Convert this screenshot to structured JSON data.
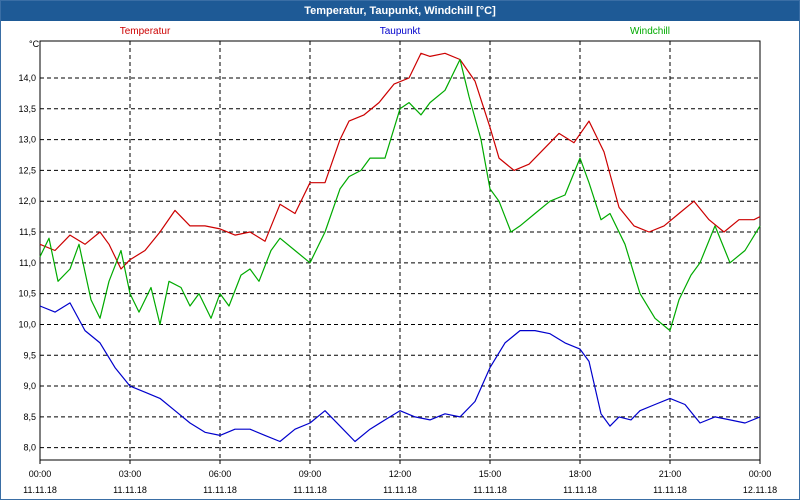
{
  "window": {
    "title": "Temperatur, Taupunkt, Windchill [°C]"
  },
  "chart_data": {
    "type": "line",
    "title": "Temperatur, Taupunkt, Windchill [°C]",
    "yunit": "°C",
    "ylim": [
      7.8,
      14.6
    ],
    "xlim": [
      0,
      24
    ],
    "grid": true,
    "yticks": [
      8.0,
      8.5,
      9.0,
      9.5,
      10.0,
      10.5,
      11.0,
      11.5,
      12.0,
      12.5,
      13.0,
      13.5,
      14.0
    ],
    "ytick_labels": [
      "8,0",
      "8,5",
      "9,0",
      "9,5",
      "10,0",
      "10,5",
      "11,0",
      "11,5",
      "12,0",
      "12,5",
      "13,0",
      "13,5",
      "14,0"
    ],
    "xticks": [
      {
        "time": "00:00",
        "date": "11.11.18",
        "hour": 0
      },
      {
        "time": "03:00",
        "date": "11.11.18",
        "hour": 3
      },
      {
        "time": "06:00",
        "date": "11.11.18",
        "hour": 6
      },
      {
        "time": "09:00",
        "date": "11.11.18",
        "hour": 9
      },
      {
        "time": "12:00",
        "date": "11.11.18",
        "hour": 12
      },
      {
        "time": "15:00",
        "date": "11.11.18",
        "hour": 15
      },
      {
        "time": "18:00",
        "date": "11.11.18",
        "hour": 18
      },
      {
        "time": "21:00",
        "date": "11.11.18",
        "hour": 21
      },
      {
        "time": "00:00",
        "date": "12.11.18",
        "hour": 24
      }
    ],
    "legend_placement": "top",
    "series": [
      {
        "name": "Temperatur",
        "color": "#cc0000",
        "x": [
          0,
          0.5,
          1,
          1.5,
          2,
          2.3,
          2.7,
          3,
          3.5,
          4,
          4.5,
          5,
          5.5,
          6,
          6.5,
          7,
          7.5,
          8,
          8.5,
          9,
          9.5,
          10,
          10.3,
          10.8,
          11.3,
          11.8,
          12.3,
          12.7,
          13,
          13.5,
          14,
          14.5,
          15,
          15.3,
          15.8,
          16.3,
          16.8,
          17.3,
          17.8,
          18.3,
          18.8,
          19.3,
          19.8,
          20.3,
          20.8,
          21.3,
          21.8,
          22.3,
          22.8,
          23.3,
          23.8,
          24
        ],
        "values": [
          11.3,
          11.2,
          11.45,
          11.3,
          11.5,
          11.3,
          10.9,
          11.05,
          11.2,
          11.5,
          11.85,
          11.6,
          11.6,
          11.55,
          11.45,
          11.5,
          11.35,
          11.95,
          11.8,
          12.3,
          12.3,
          13.0,
          13.3,
          13.4,
          13.6,
          13.9,
          14.0,
          14.4,
          14.35,
          14.4,
          14.3,
          13.95,
          13.2,
          12.7,
          12.5,
          12.6,
          12.85,
          13.1,
          12.95,
          13.3,
          12.8,
          11.9,
          11.6,
          11.5,
          11.6,
          11.8,
          12.0,
          11.7,
          11.5,
          11.7,
          11.7,
          11.75
        ]
      },
      {
        "name": "Taupunkt",
        "color": "#0000cc",
        "x": [
          0,
          0.5,
          1,
          1.5,
          2,
          2.5,
          3,
          3.5,
          4,
          4.5,
          5,
          5.5,
          6,
          6.5,
          7,
          7.5,
          8,
          8.5,
          9,
          9.5,
          10,
          10.5,
          11,
          11.5,
          12,
          12.5,
          13,
          13.5,
          14,
          14.5,
          15,
          15.5,
          16,
          16.5,
          17,
          17.5,
          18,
          18.3,
          18.7,
          19,
          19.3,
          19.7,
          20,
          20.5,
          21,
          21.5,
          22,
          22.5,
          23,
          23.5,
          24
        ],
        "values": [
          10.3,
          10.2,
          10.35,
          9.9,
          9.7,
          9.3,
          9.0,
          8.9,
          8.8,
          8.6,
          8.4,
          8.25,
          8.2,
          8.3,
          8.3,
          8.2,
          8.1,
          8.3,
          8.4,
          8.6,
          8.35,
          8.1,
          8.3,
          8.45,
          8.6,
          8.5,
          8.45,
          8.55,
          8.5,
          8.75,
          9.3,
          9.7,
          9.9,
          9.9,
          9.85,
          9.7,
          9.6,
          9.4,
          8.55,
          8.35,
          8.5,
          8.45,
          8.6,
          8.7,
          8.8,
          8.7,
          8.4,
          8.5,
          8.45,
          8.4,
          8.5
        ]
      },
      {
        "name": "Windchill",
        "color": "#00aa00",
        "x": [
          0,
          0.3,
          0.6,
          1,
          1.3,
          1.7,
          2,
          2.3,
          2.7,
          3,
          3.3,
          3.7,
          4,
          4.3,
          4.7,
          5,
          5.3,
          5.7,
          6,
          6.3,
          6.7,
          7,
          7.3,
          7.7,
          8,
          8.5,
          9,
          9.5,
          10,
          10.3,
          10.7,
          11,
          11.5,
          12,
          12.3,
          12.7,
          13,
          13.5,
          14,
          14.3,
          14.7,
          15,
          15.3,
          15.7,
          16,
          16.5,
          17,
          17.5,
          18,
          18.3,
          18.7,
          19,
          19.5,
          20,
          20.5,
          21,
          21.3,
          21.7,
          22,
          22.5,
          23,
          23.5,
          24
        ],
        "values": [
          11.1,
          11.4,
          10.7,
          10.9,
          11.3,
          10.4,
          10.1,
          10.7,
          11.2,
          10.5,
          10.2,
          10.6,
          10.0,
          10.7,
          10.6,
          10.3,
          10.5,
          10.1,
          10.5,
          10.3,
          10.8,
          10.9,
          10.7,
          11.2,
          11.4,
          11.2,
          11.0,
          11.5,
          12.2,
          12.4,
          12.5,
          12.7,
          12.7,
          13.5,
          13.6,
          13.4,
          13.6,
          13.8,
          14.3,
          13.7,
          13.0,
          12.2,
          12.0,
          11.5,
          11.6,
          11.8,
          12.0,
          12.1,
          12.7,
          12.3,
          11.7,
          11.8,
          11.3,
          10.5,
          10.1,
          9.9,
          10.4,
          10.8,
          11.0,
          11.6,
          11.0,
          11.2,
          11.6
        ]
      }
    ]
  }
}
